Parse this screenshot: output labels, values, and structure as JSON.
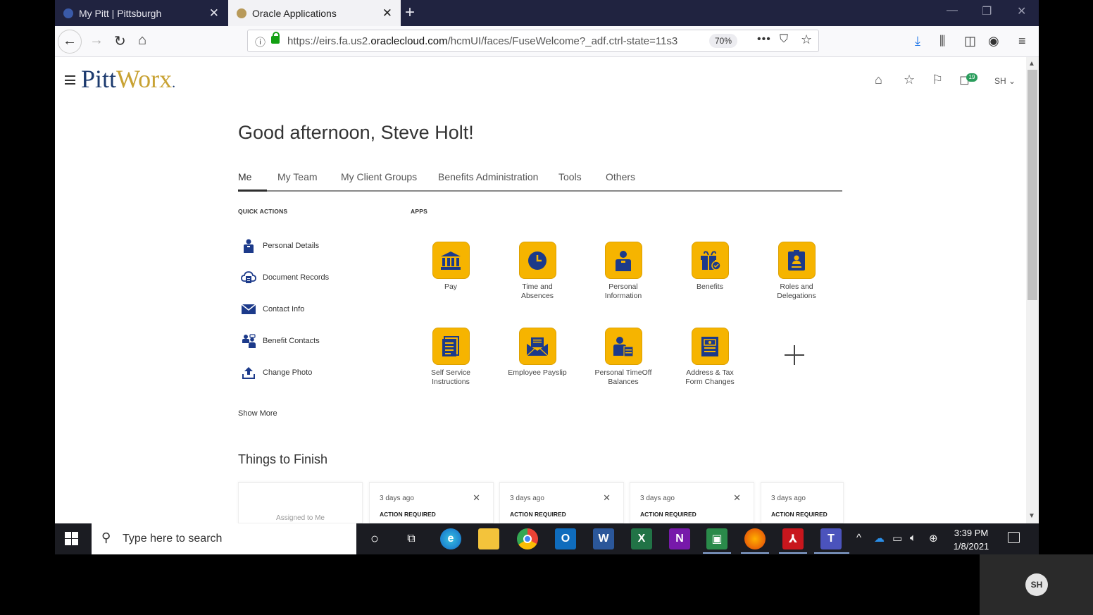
{
  "browser": {
    "tabs": [
      {
        "title": "My Pitt | Pittsburgh",
        "active": false
      },
      {
        "title": "Oracle Applications",
        "active": true
      }
    ],
    "url_prefix": "https://eirs.fa.us2.",
    "url_host": "oraclecloud.com",
    "url_path": "/hcmUI/faces/FuseWelcome?_adf.ctrl-state=11s3",
    "zoom": "70%"
  },
  "header": {
    "logo_pitt": "Pitt",
    "logo_worx": "Worx",
    "notification_count": "19",
    "user_initials": "SH"
  },
  "greeting": "Good afternoon, Steve Holt!",
  "nav_tabs": [
    "Me",
    "My Team",
    "My Client Groups",
    "Benefits Administration",
    "Tools",
    "Others"
  ],
  "quick_actions": {
    "label": "QUICK ACTIONS",
    "items": [
      "Personal Details",
      "Document Records",
      "Contact Info",
      "Benefit Contacts",
      "Change Photo"
    ],
    "show_more": "Show More"
  },
  "apps": {
    "label": "APPS",
    "items": [
      {
        "line1": "Pay",
        "line2": "",
        "icon": "bank-icon"
      },
      {
        "line1": "Time and",
        "line2": "Absences",
        "icon": "clock-icon"
      },
      {
        "line1": "Personal",
        "line2": "Information",
        "icon": "person-badge-icon"
      },
      {
        "line1": "Benefits",
        "line2": "",
        "icon": "gift-icon"
      },
      {
        "line1": "Roles and",
        "line2": "Delegations",
        "icon": "id-card-icon"
      },
      {
        "line1": "Self Service",
        "line2": "Instructions",
        "icon": "document-list-icon"
      },
      {
        "line1": "Employee Payslip",
        "line2": "",
        "icon": "envelope-icon"
      },
      {
        "line1": "Personal TimeOff",
        "line2": "Balances",
        "icon": "person-calendar-icon"
      },
      {
        "line1": "Address & Tax",
        "line2": "Form Changes",
        "icon": "form-icon"
      }
    ]
  },
  "things_to_finish": {
    "title": "Things to Finish",
    "first_card": "Assigned to Me",
    "cards": [
      {
        "ago": "3 days ago",
        "status": "ACTION REQUIRED"
      },
      {
        "ago": "3 days ago",
        "status": "ACTION REQUIRED"
      },
      {
        "ago": "3 days ago",
        "status": "ACTION REQUIRED"
      },
      {
        "ago": "3 days ago",
        "status": "ACTION REQUIRED"
      }
    ]
  },
  "taskbar": {
    "search_placeholder": "Type here to search",
    "time": "3:39 PM",
    "date": "1/8/2021"
  },
  "call_overlay": {
    "initials": "SH"
  },
  "colors": {
    "tile": "#f6b400",
    "icon_blue": "#1c3a8a",
    "tabbar": "#202340"
  }
}
